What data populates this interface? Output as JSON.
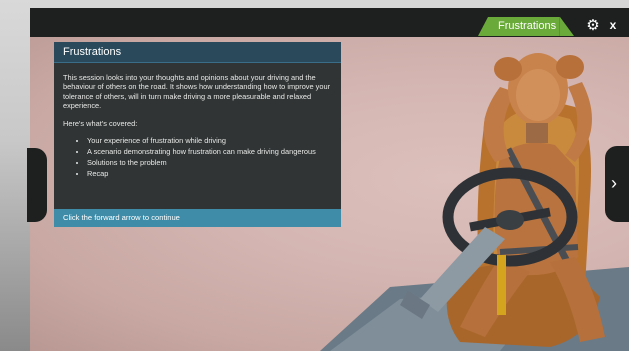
{
  "header": {
    "tab_label": "Frustrations",
    "close_label": "x",
    "gear_symbol": "⚙",
    "accent_color": "#6aaa3a"
  },
  "navigation": {
    "next_symbol": "›"
  },
  "panel": {
    "title": "Frustrations",
    "intro": "This session looks into your thoughts and opinions about your driving and the behaviour of others on the road. It shows how understanding how to improve your tolerance of others, will in turn make driving a more pleasurable and relaxed experience.",
    "covered_heading": "Here's what's covered:",
    "items": [
      "Your experience of frustration while driving",
      "A scenario demonstrating how frustration can make driving dangerous",
      "Solutions to the problem",
      "Recap"
    ],
    "footer": "Click the forward arrow to continue"
  }
}
